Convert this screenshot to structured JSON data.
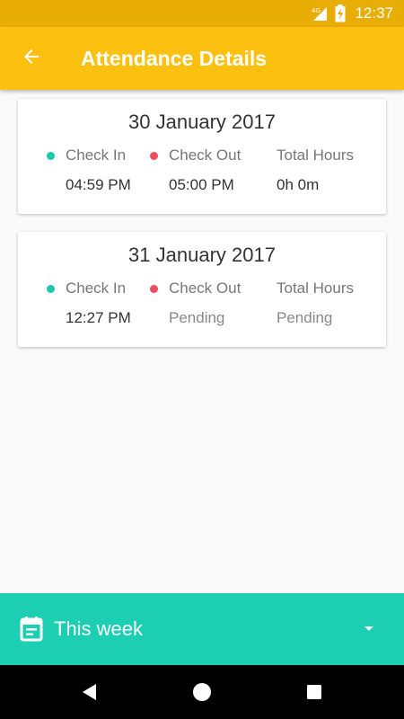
{
  "status_bar": {
    "network": "4G",
    "time": "12:37"
  },
  "header": {
    "title": "Attendance Details",
    "back_icon": "arrow-back-icon"
  },
  "labels": {
    "check_in": "Check In",
    "check_out": "Check Out",
    "total_hours": "Total Hours"
  },
  "records": [
    {
      "date": "30 January 2017",
      "check_in": "04:59 PM",
      "check_out": "05:00 PM",
      "total_hours": "0h 0m"
    },
    {
      "date": "31 January 2017",
      "check_in": "12:27 PM",
      "check_out": "Pending",
      "total_hours": "Pending"
    }
  ],
  "filter": {
    "label": "This week",
    "icon": "calendar-icon",
    "dropdown_icon": "dropdown-arrow-icon"
  },
  "colors": {
    "status_bar": "#e9ae06",
    "app_bar": "#fcc110",
    "check_in_dot": "#1dc7b0",
    "check_out_dot": "#ee4d5c",
    "bottom_bar": "#1ccfb3"
  }
}
